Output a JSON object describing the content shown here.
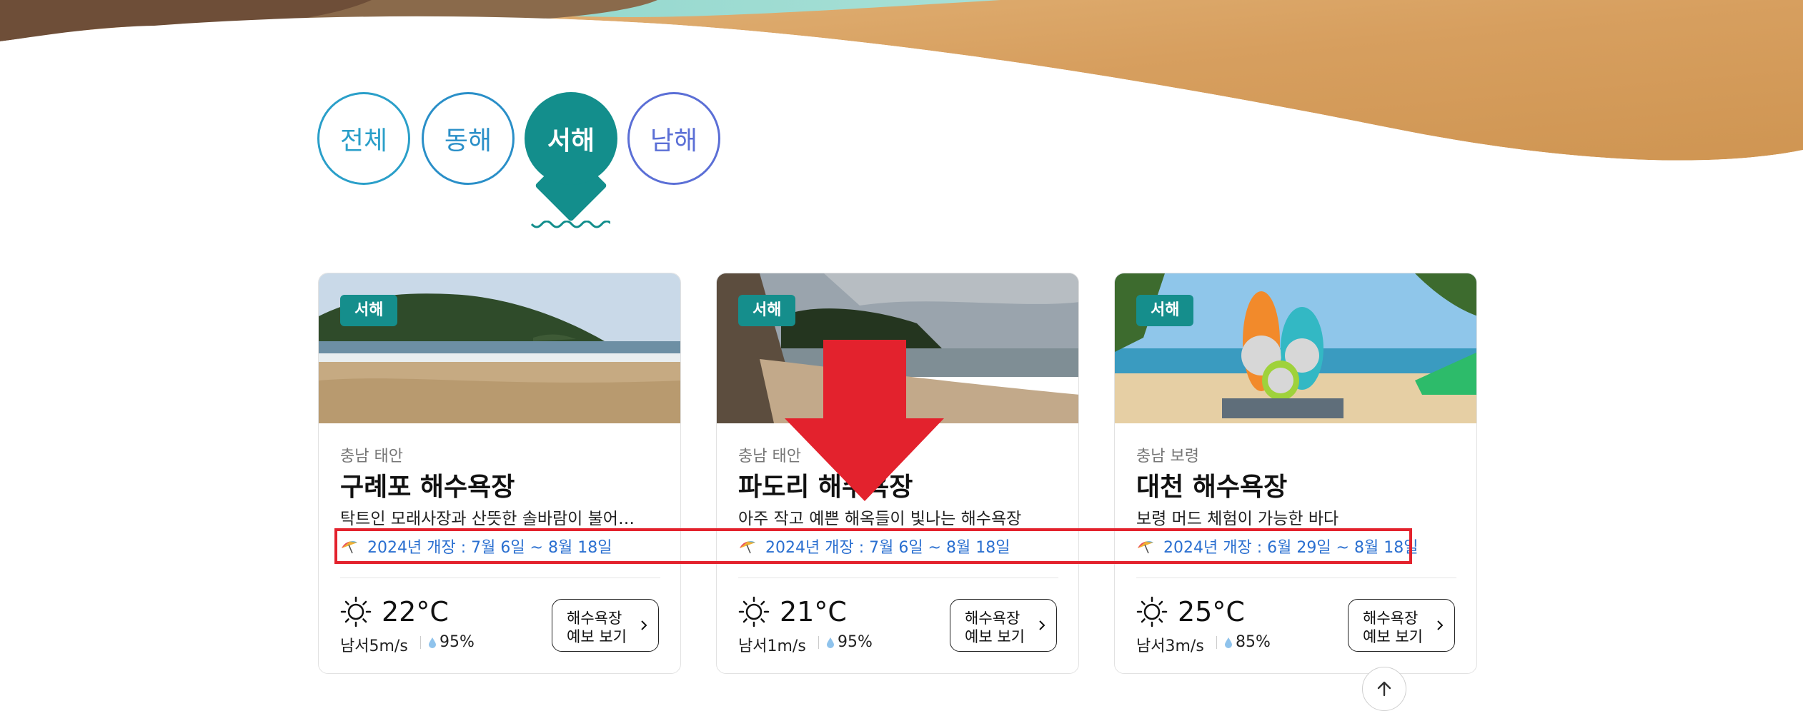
{
  "tabs": [
    {
      "label": "전체"
    },
    {
      "label": "동해"
    },
    {
      "label": "서해",
      "selected": true
    },
    {
      "label": "남해"
    }
  ],
  "cards": [
    {
      "region_badge": "서해",
      "location": "충남 태안",
      "name": "구례포 해수욕장",
      "description": "탁트인 모래사장과 산뜻한 솔바람이 불어오는 해수욕장",
      "opening": "2024년 개장 : 7월 6일 ~ 8월 18일",
      "temperature": "22°C",
      "wind": "남서5m/s",
      "humidity": "95%",
      "forecast_line1": "해수욕장",
      "forecast_line2": "예보 보기"
    },
    {
      "region_badge": "서해",
      "location": "충남 태안",
      "name": "파도리 해수욕장",
      "description": "아주 작고 예쁜 해옥들이 빛나는 해수욕장",
      "opening": "2024년 개장 : 7월 6일 ~ 8월 18일",
      "temperature": "21°C",
      "wind": "남서1m/s",
      "humidity": "95%",
      "forecast_line1": "해수욕장",
      "forecast_line2": "예보 보기"
    },
    {
      "region_badge": "서해",
      "location": "충남 보령",
      "name": "대천 해수욕장",
      "description": "보령 머드 체험이 가능한 바다",
      "opening": "2024년 개장 : 6월 29일 ~ 8월 18일",
      "temperature": "25°C",
      "wind": "남서3m/s",
      "humidity": "85%",
      "forecast_line1": "해수욕장",
      "forecast_line2": "예보 보기"
    }
  ],
  "colors": {
    "selected_tab": "#138e8c",
    "badge": "#158e8c",
    "opening_text": "#2a6fd0",
    "highlight": "#e3222d",
    "sand": "#d9a566"
  },
  "icons": [
    "sun-icon",
    "umbrella-icon",
    "drop-icon",
    "chevron-right-icon",
    "arrow-up-icon"
  ]
}
